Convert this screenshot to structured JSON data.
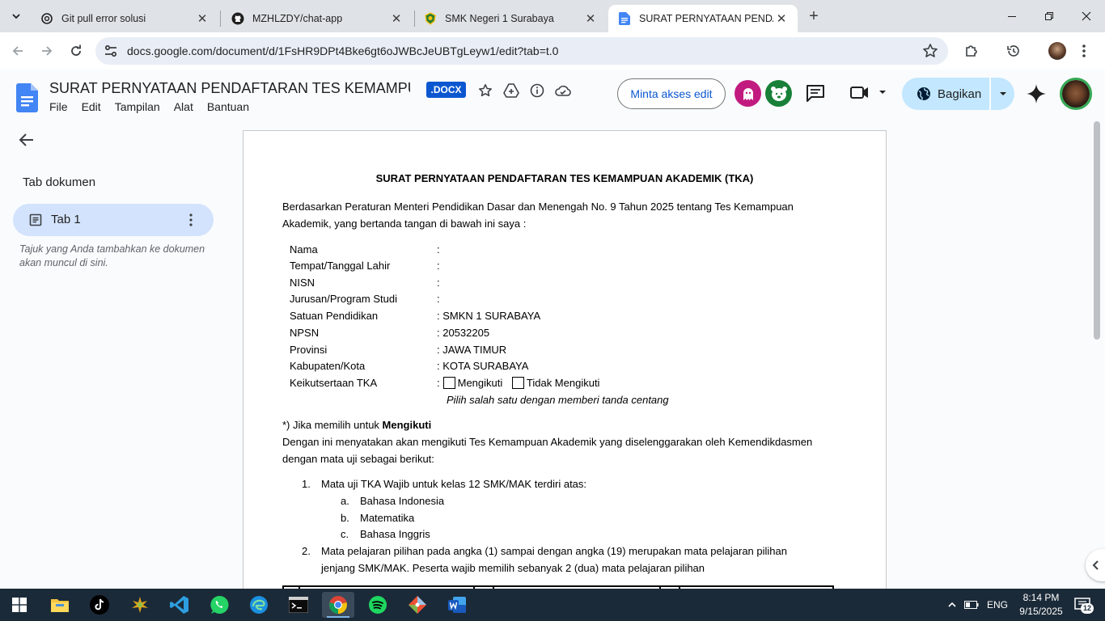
{
  "browser": {
    "tabs": [
      {
        "title": "Git pull error solusi",
        "icon": "chatgpt-icon"
      },
      {
        "title": "MZHLZDY/chat-app",
        "icon": "github-icon"
      },
      {
        "title": "SMK Negeri 1 Surabaya",
        "icon": "school-logo-icon"
      },
      {
        "title": "SURAT PERNYATAAN PENDAFTA",
        "icon": "google-docs-icon",
        "active": true
      }
    ],
    "url": "docs.google.com/document/d/1FsHR9DPt4Bke6gt6oJWBcJeUBTgLeyw1/edit?tab=t.0"
  },
  "docs": {
    "title": "SURAT PERNYATAAN PENDAFTARAN TES KEMAMPUA...",
    "badge": ".DOCX",
    "menu": [
      "File",
      "Edit",
      "Tampilan",
      "Alat",
      "Bantuan"
    ],
    "request_edit": "Minta akses edit",
    "share": "Bagikan"
  },
  "sidebar": {
    "heading": "Tab dokumen",
    "tab_label": "Tab 1",
    "hint": "Tajuk yang Anda tambahkan ke dokumen akan muncul di sini."
  },
  "document": {
    "title": "SURAT PERNYATAAN PENDAFTARAN TES KEMAMPUAN AKADEMIK (TKA)",
    "intro_1": "Berdasarkan Peraturan Menteri Pendidikan Dasar dan Menengah No. 9 Tahun 2025 tentang Tes Kemampuan",
    "intro_2": "Akademik, yang bertanda tangan di bawah ini saya :",
    "fields": [
      {
        "label": "Nama",
        "value": ":"
      },
      {
        "label": "Tempat/Tanggal Lahir",
        "value": ":"
      },
      {
        "label": "NISN",
        "value": ":"
      },
      {
        "label": "Jurusan/Program Studi",
        "value": ":"
      },
      {
        "label": "Satuan Pendidikan",
        "value": ": SMKN 1 SURABAYA"
      },
      {
        "label": "NPSN",
        "value": ": 20532205"
      },
      {
        "label": "Provinsi",
        "value": ": JAWA TIMUR"
      },
      {
        "label": "Kabupaten/Kota",
        "value": ": KOTA SURABAYA"
      }
    ],
    "participation_label": "Keikutsertaan TKA",
    "participation_colon": ":",
    "option_1": "Mengikuti",
    "option_2": "Tidak Mengikuti",
    "choose_note": "Pilih salah satu dengan memberi tanda centang",
    "if_choose_prefix": "*) Jika memilih untuk ",
    "if_choose_bold": "Mengikuti",
    "statement_1": "Dengan ini menyatakan akan mengikuti Tes Kemampuan Akademik yang diselenggarakan oleh Kemendikdasmen",
    "statement_2": "dengan mata uji sebagai berikut:",
    "item1_num": "1.",
    "item1": "Mata uji TKA Wajib untuk kelas 12 SMK/MAK terdiri atas:",
    "subitems": [
      {
        "letter": "a.",
        "text": "Bahasa Indonesia"
      },
      {
        "letter": "b.",
        "text": "Matematika"
      },
      {
        "letter": "c.",
        "text": "Bahasa Inggris"
      }
    ],
    "item2_num": "2.",
    "item2_line1": "Mata pelajaran pilihan pada angka (1) sampai dengan angka (19) merupakan mata pelajaran pilihan",
    "item2_line2": "jenjang SMK/MAK. Peserta wajib memilih sebanyak 2 (dua) mata pelajaran pilihan"
  },
  "taskbar": {
    "lang": "ENG",
    "time": "8:14 PM",
    "date": "9/15/2025",
    "notifications": "12"
  },
  "colors": {
    "accent": "#0b57d0",
    "share_bg": "#c2e7ff",
    "tab_selected": "#d3e3fd",
    "taskbar": "#1b2a38"
  }
}
